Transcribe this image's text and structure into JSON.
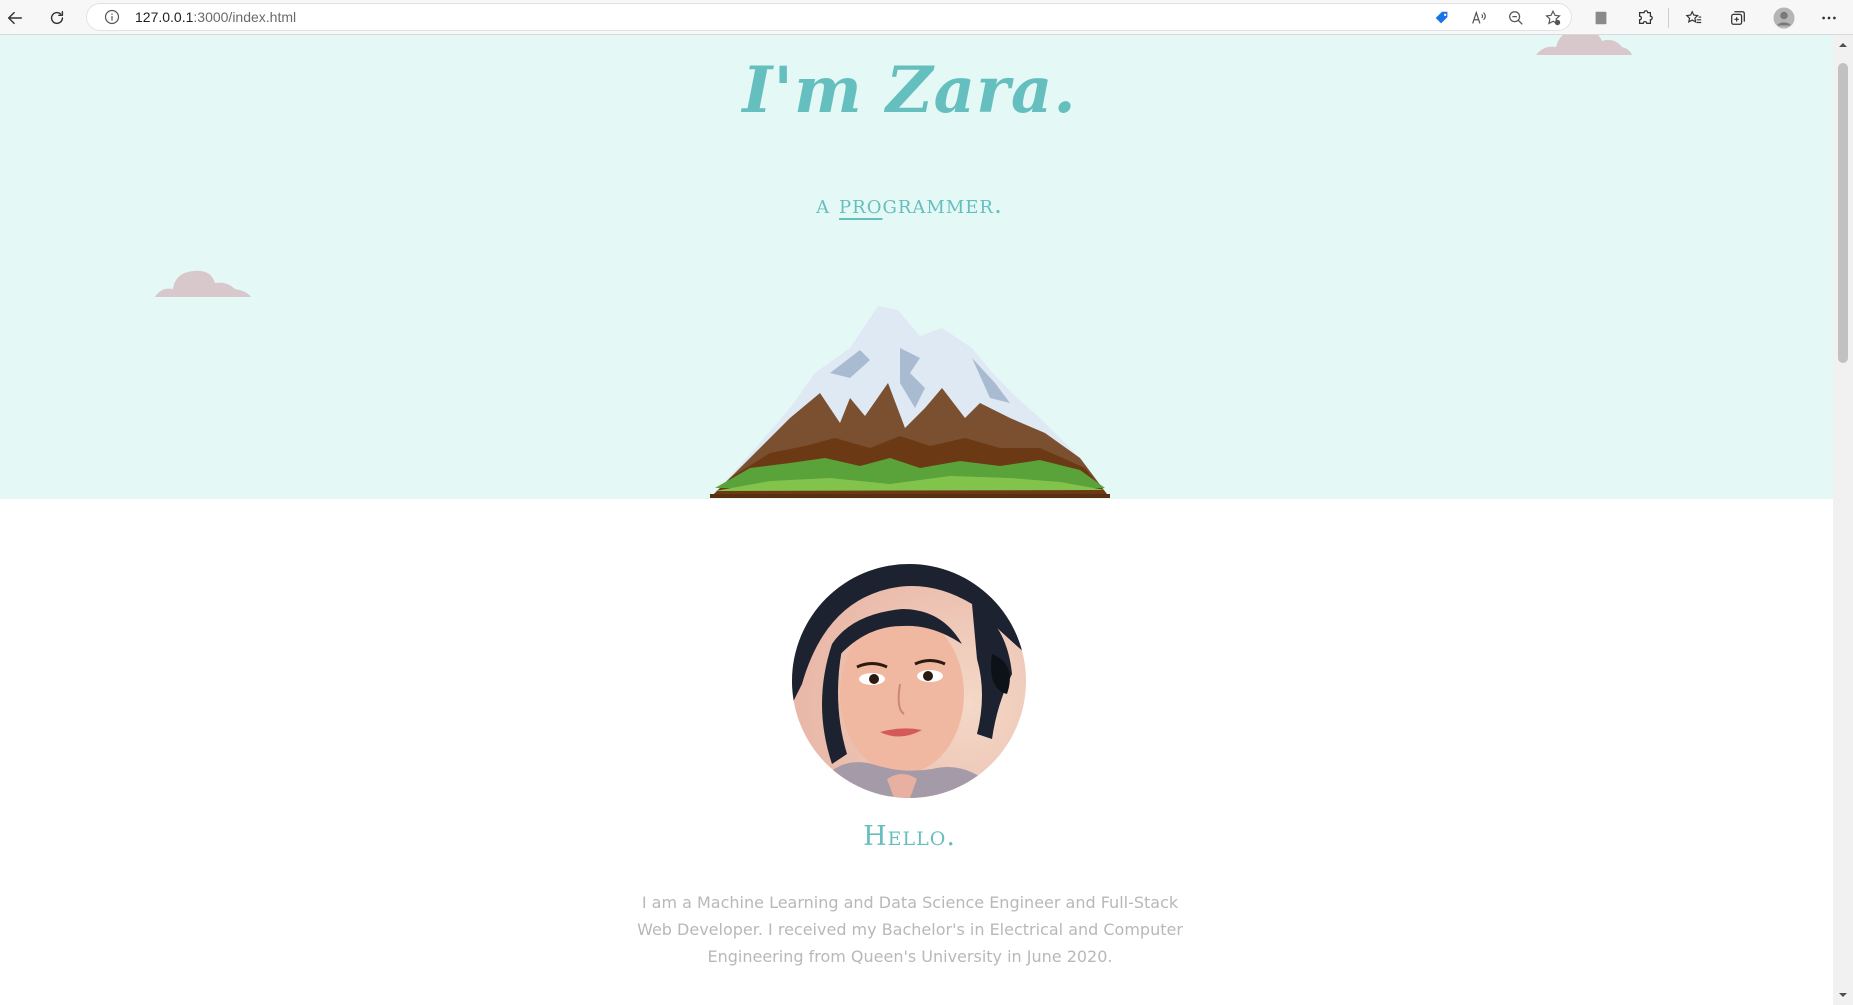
{
  "browser": {
    "url_host": "127.0.0.1",
    "url_rest": ":3000/index.html"
  },
  "hero": {
    "title": "I'm Zara.",
    "subtitle_prefix": "a ",
    "subtitle_underlined": "pro",
    "subtitle_suffix": "grammer.",
    "colors": {
      "background": "#e4f8f5",
      "accent": "#66bfbf",
      "cloud": "#d8c8cc"
    }
  },
  "about": {
    "heading": "Hello.",
    "bio": "I am a Machine Learning and Data Science Engineer and Full-Stack Web Developer. I received my Bachelor's in Electrical and Computer Engineering from Queen's University in June 2020."
  },
  "icons": {
    "toolbar": [
      "back-arrow-icon",
      "refresh-icon",
      "info-icon"
    ],
    "address_bar": [
      "tag-icon",
      "read-aloud-icon",
      "zoom-out-icon",
      "add-favorite-icon"
    ],
    "right": [
      "reading-view-icon",
      "extensions-icon",
      "favorites-icon",
      "collections-icon",
      "profile-icon",
      "more-menu-icon"
    ]
  }
}
